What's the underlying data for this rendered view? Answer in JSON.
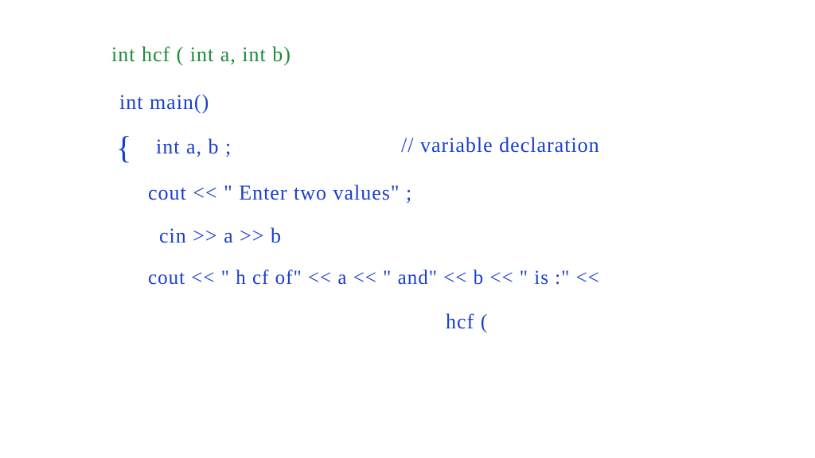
{
  "code": {
    "line1": "int   hcf ( int a, int b)",
    "line2": "int main()",
    "line3_brace": "{",
    "line3_text": "int  a, b ;",
    "line3_comment": "// variable  declaration",
    "line4": "cout << \" Enter two values\" ;",
    "line5": "cin  >> a  >> b",
    "line6": "cout  <<  \" h cf  of\"  << a  << \" and\"  << b  << \" is :\" <<",
    "line7": "hcf ("
  }
}
